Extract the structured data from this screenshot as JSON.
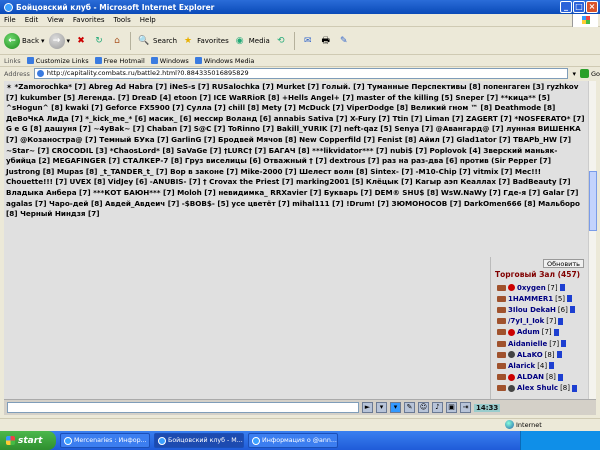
{
  "window": {
    "title": "Бойцовский клуб - Microsoft Internet Explorer"
  },
  "menu": [
    "File",
    "Edit",
    "View",
    "Favorites",
    "Tools",
    "Help"
  ],
  "toolbar": {
    "back": "Back",
    "search": "Search",
    "favorites": "Favorites",
    "media": "Media"
  },
  "links": {
    "label": "Links",
    "items": [
      "Customize Links",
      "Free Hotmail",
      "Windows",
      "Windows Media"
    ]
  },
  "address": {
    "label": "Address",
    "url": "http://capitality.combats.ru/battle2.html?0.884335016895829",
    "go": "Go"
  },
  "battle_text": "✶ *Zamorochka* [7] Abreg Ad Habra [7] iNeS-s [7] RUSalochka [7] Murket [7] Голый. [7] Туманные Перспективы [8] попенгаген [3] ryzhkov [7] kukumber [5] Легенда. [7] DreaD [4] etoon [7] ICE WaRRioR [8] +Hells Angel+ [7] master of the killing [5] Sneper [7] **кица** [5] ^sHogun^ [8] kwaki [7] Geforce FX5900 [7] Сулла [7] chill [8] Mety [7] McDuck [7] ViperDodge [8] Великий гном ™ [8] Deathmode [8] ДеВоЧкА ЛиДа [7] *_kick_me_* [6] масик_ [6] мессир Воланд [6] annabis Sativa [7] X-Fury [7] Ttin [7] Liman [7] ZAGERT [7] *NOSFERATO* [7] G e G [8] дашуня [7] ~4уBak~ [7] Chaban [7] S@C [7] ToRinno [7] Bakill_YURIK [7] neft-qaz [5] Senya [7] @Авангард@ [7] лунная ВИШЕНКА [7] @Козаностра@ [7] Темный БУка [7] GarlinG [7] Бродвей Мячов [8] New Copperfild [7] Fenist [8] Айил [7] Glad1ator [7] TBAPb_HW [7] ~Star~ [7] CROCODIL [3] *ChaosLord* [8] SaVaGe [7] †LURC† [7] БАГАЧ [8] ***likvidator*** [7] nubi$ [7] Poplovok [4] Зверский маньяк-убийца [2] MEGAFINGER [7] СТАЛКЕР-7 [8] Груз виселицы [6] Отважный † [7] dextrous [7] раз на раз-два [6] против (Sir Pepper [7] Justrong [8] Mupas [8] _t_TANDER_t_ [7] Вор в законе [7] Mike-2000 [7] Шелест волн [8] Sintex- [7] -M10-Chip [7] vitmix [7] Мес!!! Chouette!!! [7] UVEX [8] VidJey [6] -ANUBIS- [7] † Crovax the Priest [7] marking2001 [5] Клёцык [7] Кагыр аэп Кеаллах [7] BadBeauty [7] Владыка Анбера [7] ***КОТ БАЮН*** [7] Moloh [7] невидимка_ RRXavier [7] Букварь [7] DEM® SHU$ [8] WsW.NaWy [7] Где-я [7] Galar [7] agalas [7] Чаро-дей [8] Авдей_Авдеич [7] -$BOB$- [5] yce цветёт [7] mihal111 [7] !Drum! [7] ЗЮМОНОСОВ [7] DarkOmen666 [8] Мальборо [8] Черный Ниндзя [7]",
  "room": {
    "refresh": "Обновить",
    "title": "Торговый Зал (457)",
    "users": [
      {
        "name": "0xygen",
        "level": "[7]"
      },
      {
        "name": "1HAMMER1",
        "level": "[5]"
      },
      {
        "name": "3Ilou DekaH",
        "level": "[6]"
      },
      {
        "name": "/7yI_I_Iok",
        "level": "[7]"
      },
      {
        "name": "Adum",
        "level": "[7]"
      },
      {
        "name": "Aidanielle",
        "level": "[7]"
      },
      {
        "name": "ALaKO",
        "level": "[8]"
      },
      {
        "name": "Alarick",
        "level": "[4]"
      },
      {
        "name": "ALDAN",
        "level": "[8]"
      },
      {
        "name": "Alex Shulc",
        "level": "[8]"
      }
    ]
  },
  "chat_clock": "14:33",
  "status": {
    "zone": "Internet"
  },
  "taskbar": {
    "start": "start",
    "tasks": [
      "Mercenaries : Инфор...",
      "Бойцовский клуб - M...",
      "Информация о @ann..."
    ]
  }
}
